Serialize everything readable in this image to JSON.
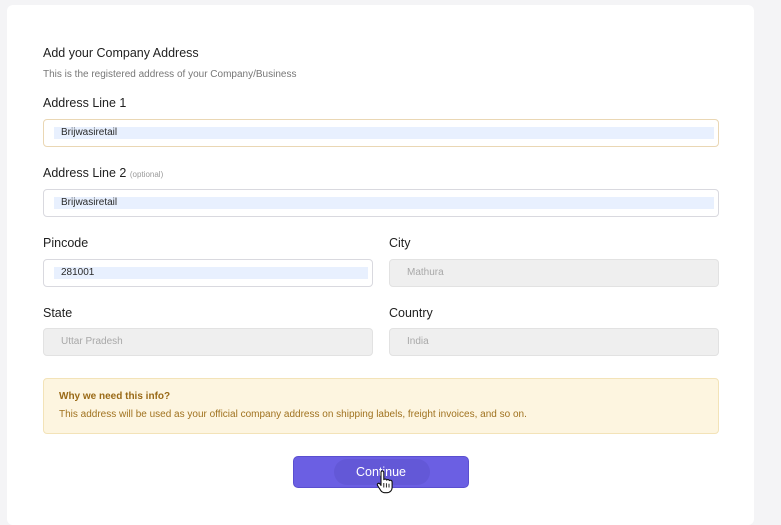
{
  "address_section": {
    "title": "Add your Company Address",
    "subtitle": "This is the registered address of your Company/Business"
  },
  "fields": {
    "address_line_1": {
      "label": "Address Line 1",
      "value": "Brijwasiretail"
    },
    "address_line_2": {
      "label": "Address Line 2",
      "optional_tag": "(optional)",
      "value": "Brijwasiretail"
    },
    "pincode": {
      "label": "Pincode",
      "value": "281001"
    },
    "city": {
      "label": "City",
      "value": "Mathura"
    },
    "state": {
      "label": "State",
      "value": "Uttar Pradesh"
    },
    "country": {
      "label": "Country",
      "value": "India"
    }
  },
  "info_box": {
    "title": "Why we need this info?",
    "text": "This address will be used as your official company address on shipping labels, freight invoices, and so on."
  },
  "continue_button": {
    "label": "Continue"
  },
  "colors": {
    "accent": "#6b5fe3",
    "info_bg": "#fdf5e0",
    "info_text": "#a0721f"
  },
  "icons": {
    "cursor": "hand-pointer-icon"
  }
}
